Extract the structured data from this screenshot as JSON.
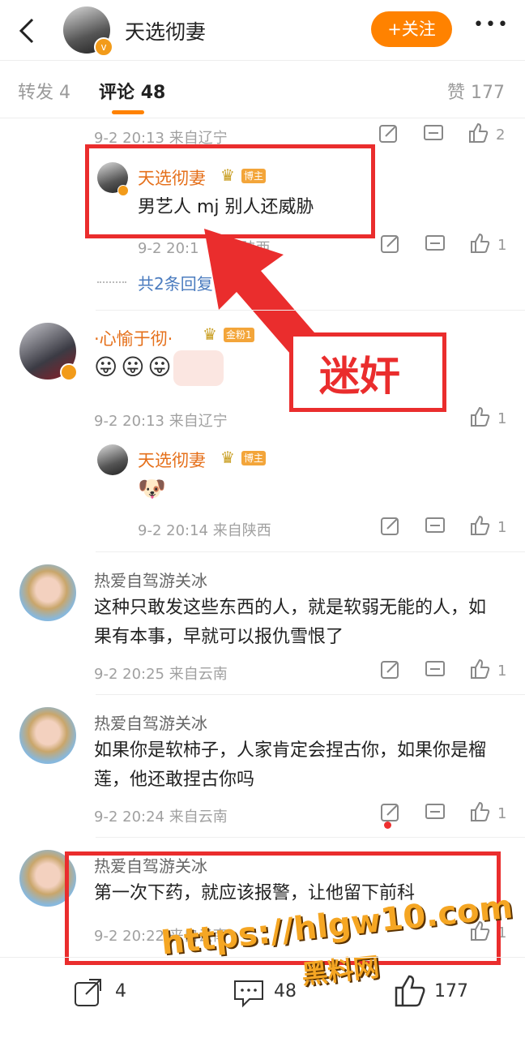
{
  "header": {
    "name": "天选彻妻",
    "follow_label": "+关注",
    "more": "•••"
  },
  "tabs": {
    "repost": "转发 4",
    "comments_label": "评论",
    "comments_count": "48",
    "likes": "赞 177"
  },
  "comments": [
    {
      "meta": "9-2 20:13 来自辽宁",
      "likes": "2"
    },
    {
      "name": "天选彻妻",
      "badge": "博主",
      "text": "男艺人 mj 别人还威胁",
      "meta": "9-2 20:1",
      "meta_tail": "自陕西",
      "likes": "1"
    },
    {
      "more_replies": "共2条回复"
    },
    {
      "name": "·心愉于彻·",
      "badge": "金粉1",
      "emoji": "😛😛😛",
      "meta": "9-2 20:13 来自辽宁",
      "likes": "1"
    },
    {
      "name": "天选彻妻",
      "badge": "博主",
      "emoji": "🐶",
      "meta": "9-2 20:14 来自陕西",
      "likes": "1"
    },
    {
      "name": "热爱自驾游关冰",
      "text": "这种只敢发这些东西的人，就是软弱无能的人，如果有本事，早就可以报仇雪恨了",
      "meta": "9-2 20:25 来自云南",
      "likes": "1"
    },
    {
      "name": "热爱自驾游关冰",
      "text": "如果你是软柿子，人家肯定会捏古你，如果你是榴莲，他还敢捏古你吗",
      "meta": "9-2 20:24 来自云南",
      "likes": "1"
    },
    {
      "name": "热爱自驾游关冰",
      "text": "第一次下药，就应该报警，让他留下前科",
      "meta": "9-2 20:22 来自云南",
      "likes": "1"
    }
  ],
  "annotation": {
    "label": "迷奸"
  },
  "watermark": {
    "url": "https://hlgw10.com",
    "site": "黑料网"
  },
  "bottom": {
    "repost": "4",
    "comment": "48",
    "like": "177"
  }
}
